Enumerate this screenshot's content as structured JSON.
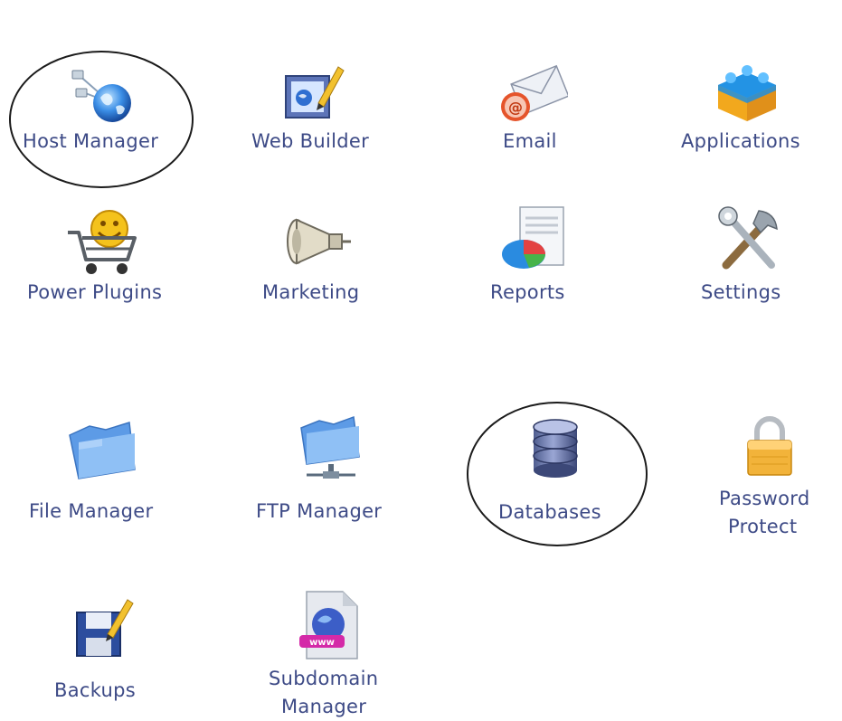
{
  "panel": {
    "rows": [
      {
        "items": [
          {
            "id": "host-manager",
            "label": "Host Manager",
            "icon": "globe-network-icon",
            "highlighted": true
          },
          {
            "id": "web-builder",
            "label": "Web Builder",
            "icon": "web-builder-icon",
            "highlighted": false
          },
          {
            "id": "email",
            "label": "Email",
            "icon": "email-icon",
            "highlighted": false
          },
          {
            "id": "applications",
            "label": "Applications",
            "icon": "applications-icon",
            "highlighted": false
          }
        ]
      },
      {
        "items": [
          {
            "id": "power-plugins",
            "label": "Power Plugins",
            "icon": "power-plugins-cart-icon",
            "highlighted": false
          },
          {
            "id": "marketing",
            "label": "Marketing",
            "icon": "megaphone-icon",
            "highlighted": false
          },
          {
            "id": "reports",
            "label": "Reports",
            "icon": "reports-chart-icon",
            "highlighted": false
          },
          {
            "id": "settings",
            "label": "Settings",
            "icon": "tools-icon",
            "highlighted": false
          }
        ]
      },
      {
        "items": [
          {
            "id": "file-manager",
            "label": "File Manager",
            "icon": "folder-icon",
            "highlighted": false
          },
          {
            "id": "ftp-manager",
            "label": "FTP Manager",
            "icon": "ftp-folder-icon",
            "highlighted": false
          },
          {
            "id": "databases",
            "label": "Databases",
            "icon": "database-icon",
            "highlighted": true
          },
          {
            "id": "password-protect",
            "label_lines": [
              "Password",
              "Protect"
            ],
            "icon": "padlock-icon",
            "highlighted": false
          }
        ]
      },
      {
        "items": [
          {
            "id": "backups",
            "label": "Backups",
            "icon": "backup-disk-icon",
            "highlighted": false
          },
          {
            "id": "subdomain-manager",
            "label_lines": [
              "Subdomain",
              "Manager"
            ],
            "icon": "subdomain-document-icon",
            "highlighted": false
          }
        ]
      }
    ],
    "label_color": "#3d4a86",
    "highlight_ring_color": "#1b1b1b"
  }
}
